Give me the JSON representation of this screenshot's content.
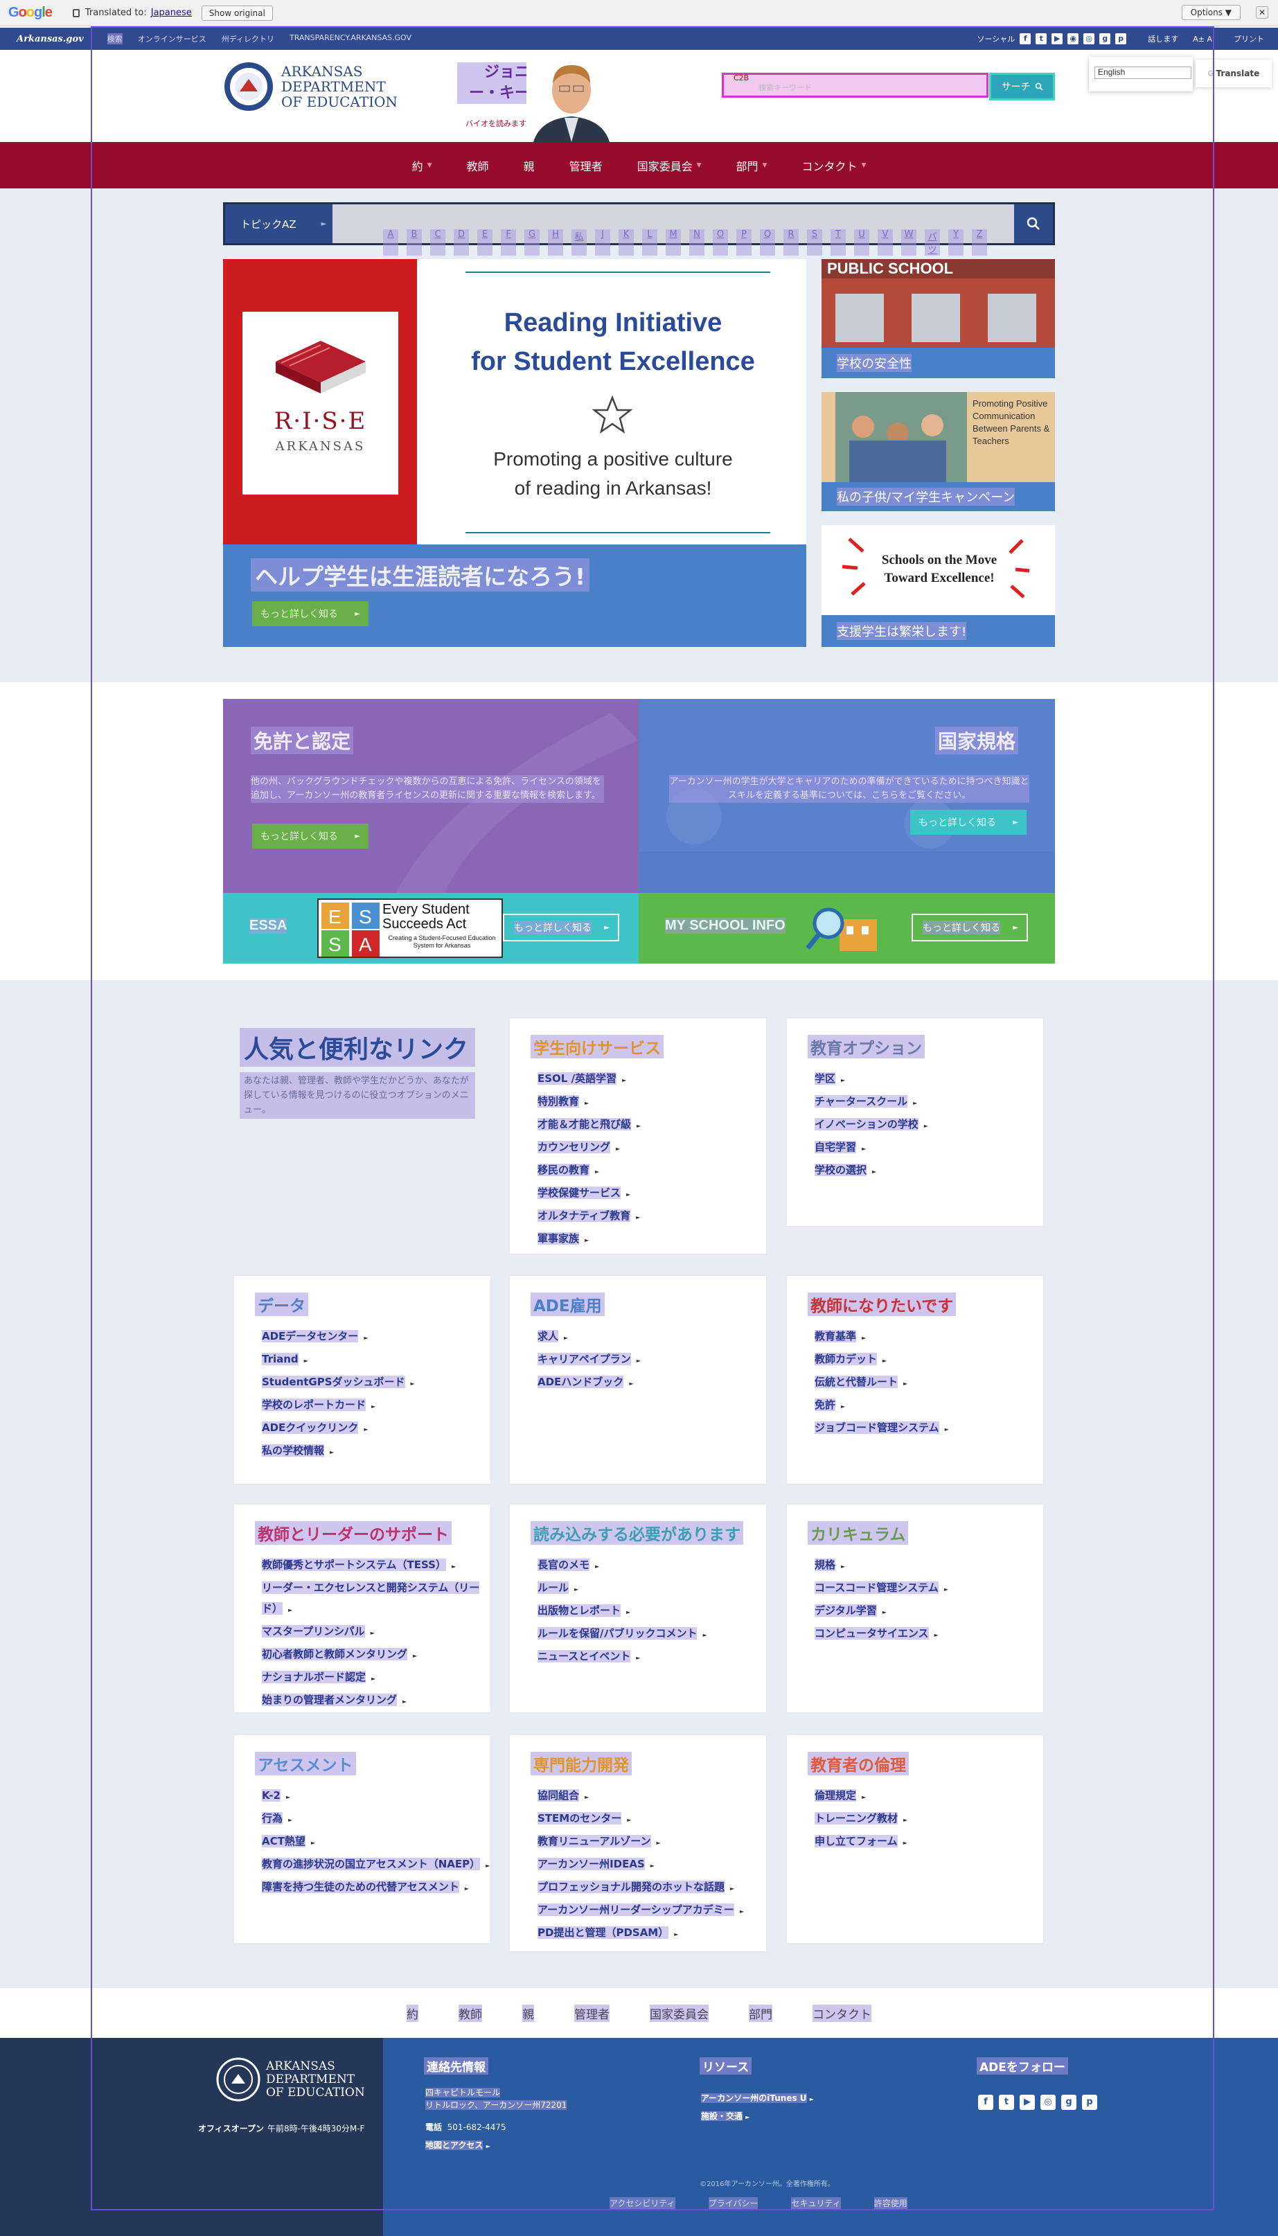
{
  "translate_bar": {
    "logo": "Google",
    "translated_to": "Translated to:",
    "language": "Japanese",
    "show_original": "Show original",
    "options": "Options ▼",
    "close": "✕"
  },
  "utility": {
    "ark_gov": "Arkansas.gov",
    "links": [
      "検索",
      "オンラインサービス",
      "州ディレクトリ",
      "TRANSPARENCY.ARKANSAS.GOV"
    ],
    "social_label": "ソーシャル",
    "text_size": "話します",
    "print": "プリント"
  },
  "language_select": {
    "value": "English",
    "translate_label": "Translate"
  },
  "header": {
    "logo_lines": [
      "ARKANSAS",
      "DEPARTMENT",
      "OF EDUCATION"
    ],
    "hero_name": "ジョニー・キー",
    "hero_sub": "バイオを読みます",
    "search_tag": "C2B",
    "search_placeholder": "検索キーワード",
    "search_button": "サーチ"
  },
  "nav": [
    "約",
    "教師",
    "親",
    "管理者",
    "国家委員会",
    "部門",
    "コンタクト"
  ],
  "topic_az": {
    "label": "トピックAZ",
    "letters": [
      "A",
      "B",
      "C",
      "D",
      "E",
      "F",
      "G",
      "H",
      "私",
      "J",
      "K",
      "L",
      "M",
      "N",
      "O",
      "P",
      "Q",
      "R",
      "S",
      "T",
      "U",
      "V",
      "W",
      "バツ",
      "Y",
      "Z"
    ]
  },
  "carousel": {
    "rise": "R·I·S·E",
    "arkansas": "ARKANSAS",
    "headline_1": "Reading Initiative",
    "headline_2": "for Student Excellence",
    "sub_1": "Promoting a positive culture",
    "sub_2": "of reading in Arkansas!",
    "caption": "ヘルプ学生は生涯読者になろう!",
    "button": "もっと詳しく知る"
  },
  "tiles": [
    {
      "photo_text": "PUBLIC SCHOOL",
      "caption": "学校の安全性"
    },
    {
      "photo_text": "Promoting Positive Communication Between Parents & Teachers",
      "caption": "私の子供/マイ学生キャンペーン"
    },
    {
      "photo_text": "Schools on the Move Toward Excellence!",
      "caption": "支援学生は繁栄します!"
    }
  ],
  "licensure": {
    "title": "免許と認定",
    "desc": "他の州、バックグラウンドチェックや複数からの互恵による免許、ライセンスの領域を追加し、アーカンソー州の教育者ライセンスの更新に関する重要な情報を検索します。",
    "button": "もっと詳しく知る"
  },
  "standards": {
    "title": "国家規格",
    "desc": "アーカンソー州の学生が大学とキャリアのための準備ができているために持つべき知識とスキルを定義する基準については、こちらをご覧ください。",
    "button": "もっと詳しく知る"
  },
  "essa": {
    "label": "ESSA",
    "logo_title": "Every Student Succeeds Act",
    "logo_sub": "Creating a Student-Focused Education System for Arkansas",
    "button": "もっと詳しく知る"
  },
  "myschool": {
    "label": "MY SCHOOL INFO",
    "button": "もっと詳しく知る"
  },
  "popular": {
    "title": "人気と便利なリンク",
    "desc": "あなたは親、管理者、教師や学生だかどうか、あなたが探している情報を見つけるのに役立つオプションのメニュー。"
  },
  "cards": [
    {
      "title": "学生向けサービス",
      "color": "#e0942a",
      "items": [
        "ESOL /英語学習",
        "特別教育",
        "才能＆才能と飛び級",
        "カウンセリング",
        "移民の教育",
        "学校保健サービス",
        "オルタナティブ教育",
        "軍事家族"
      ]
    },
    {
      "title": "教育オプション",
      "color": "#6a7aa6",
      "items": [
        "学区",
        "チャータースクール",
        "イノベーションの学校",
        "自宅学習",
        "学校の選択"
      ]
    },
    {
      "title": "データ",
      "color": "#4a80c8",
      "items": [
        "ADEデータセンター",
        "Triand",
        "StudentGPSダッシュボード",
        "学校のレポートカード",
        "ADEクイックリンク",
        "私の学校情報"
      ]
    },
    {
      "title": "ADE雇用",
      "color": "#4a80c8",
      "items": [
        "求人",
        "キャリアペイプラン",
        "ADEハンドブック"
      ]
    },
    {
      "title": "教師になりたいです",
      "color": "#cc3030",
      "items": [
        "教育基準",
        "教師カデット",
        "伝統と代替ルート",
        "免許",
        "ジョブコード管理システム"
      ]
    },
    {
      "title": "教師とリーダーのサポート",
      "color": "#c0306a",
      "items": [
        "教師優秀とサポートシステム（TESS）",
        "リーダー・エクセレンスと開発システム（リード）",
        "マスタープリンシパル",
        "初心者教師と教師メンタリング",
        "ナショナルボード認定",
        "始まりの管理者メンタリング"
      ]
    },
    {
      "title": "読み込みする必要があります",
      "color": "#3aa0b0",
      "items": [
        "長官のメモ",
        "ルール",
        "出版物とレポート",
        "ルールを保留/パブリックコメント",
        "ニュースとイベント"
      ]
    },
    {
      "title": "カリキュラム",
      "color": "#6a9a4a",
      "items": [
        "規格",
        "コースコード管理システム",
        "デジタル学習",
        "コンピュータサイエンス"
      ]
    },
    {
      "title": "アセスメント",
      "color": "#5a8ad0",
      "items": [
        "K-2",
        "行為",
        "ACT熱望",
        "教育の進捗状況の国立アセスメント（NAEP）",
        "障害を持つ生徒のための代替アセスメント"
      ]
    },
    {
      "title": "専門能力開発",
      "color": "#e0942a",
      "items": [
        "協同組合",
        "STEMのセンター",
        "教育リニューアルゾーン",
        "アーカンソー州IDEAS",
        "プロフェッショナル開発のホットな話題",
        "アーカンソー州リーダーシップアカデミー",
        "PD提出と管理（PDSAM）"
      ]
    },
    {
      "title": "教育者の倫理",
      "color": "#e05a3a",
      "items": [
        "倫理規定",
        "トレーニング教材",
        "申し立てフォーム"
      ]
    }
  ],
  "footer_nav": [
    "約",
    "教師",
    "親",
    "管理者",
    "国家委員会",
    "部門",
    "コンタクト"
  ],
  "footer": {
    "office_label": "オフィスオープン",
    "office_hours": "午前8時-午後4時30分M-F",
    "contact_title": "連絡先情報",
    "address_1": "四キャピトルモール",
    "address_2": "リトルロック、アーカンソー州72201",
    "phone_label": "電話",
    "phone": "501-682-4475",
    "map_link": "地図とアクセス",
    "resources_title": "リソース",
    "res_1": "アーカンソー州のiTunes U",
    "res_2": "施設・交通",
    "follow_title": "ADEをフォロー",
    "copyright": "©2016年アーカンソー州。全著作権所有。",
    "legal": [
      "アクセシビリティ",
      "プライバシー",
      "セキュリティ",
      "許容使用"
    ]
  },
  "colors": {
    "nav": "#960a2c",
    "primary": "#2d4a8a",
    "accent_blue": "#4a80c8",
    "green": "#6ab04a",
    "teal": "#3ec4c6"
  }
}
